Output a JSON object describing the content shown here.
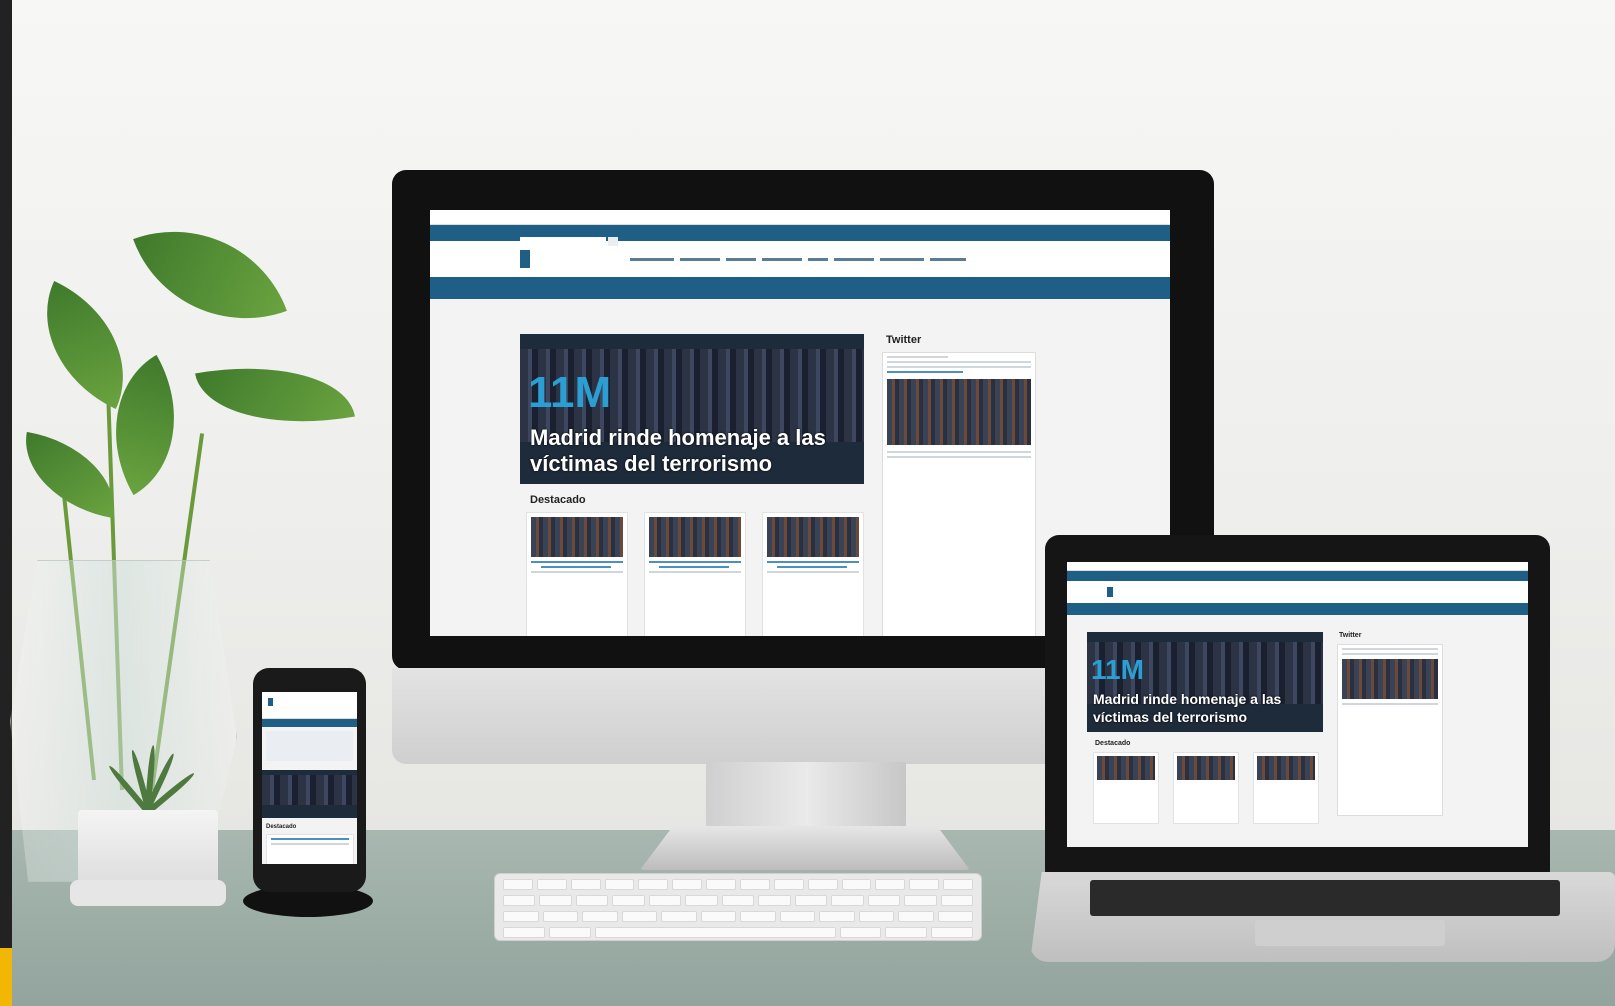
{
  "scene": {
    "background": "#eeeeec",
    "desk_color": "#9fb0a9",
    "accent_mark": "#f2b705"
  },
  "website": {
    "brand_color": "#1f5f86",
    "hero": {
      "tag": "11M",
      "title_line1": "Madrid rinde homenaje a las",
      "title_line2": "víctimas del terrorismo"
    },
    "featured_heading": "Destacado",
    "sidebar_heading": "Twitter"
  },
  "devices": [
    "imac",
    "macbook",
    "iphone",
    "keyboard"
  ]
}
